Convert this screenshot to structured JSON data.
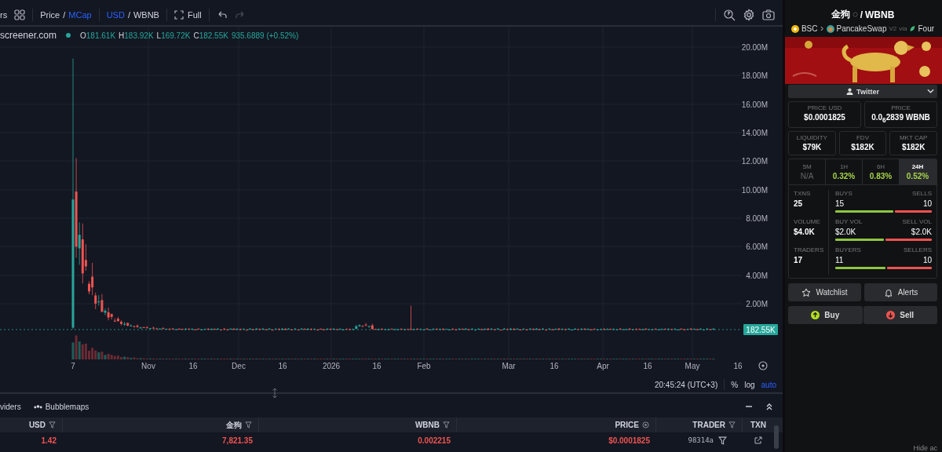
{
  "toolbar": {
    "cut_label": "rs",
    "toggles": [
      {
        "separator": "/",
        "options": [
          {
            "label": "Price",
            "selected": false
          },
          {
            "label": "MCap",
            "selected": true
          }
        ]
      },
      {
        "separator": "/",
        "options": [
          {
            "label": "USD",
            "selected": true
          },
          {
            "label": "WBNB",
            "selected": false
          }
        ]
      }
    ],
    "full_label": "Full",
    "redo_disabled": true
  },
  "legend": {
    "source": "screener.com",
    "ohlc": [
      {
        "label": "O",
        "value": "181.61K"
      },
      {
        "label": "H",
        "value": "183.92K"
      },
      {
        "label": "L",
        "value": "169.72K"
      },
      {
        "label": "C",
        "value": "182.55K"
      }
    ],
    "change": "935.6889 (+0.52%)"
  },
  "chart": {
    "y_axis": [
      "20.00M",
      "18.00M",
      "16.00M",
      "14.00M",
      "12.00M",
      "10.00M",
      "8.00M",
      "6.00M",
      "4.00M",
      "2.00M"
    ],
    "price_tag": "182.55K",
    "x_axis": [
      "7",
      "Nov",
      "16",
      "Dec",
      "16",
      "2026",
      "16",
      "Feb",
      "Mar",
      "16",
      "Apr",
      "16",
      "May",
      "16"
    ],
    "time": "20:45:24 (UTC+3)",
    "scale_buttons": [
      {
        "label": "%",
        "selected": false
      },
      {
        "label": "log",
        "selected": false
      },
      {
        "label": "auto",
        "selected": true
      }
    ]
  },
  "bottom_tabs": [
    {
      "label": "viders",
      "selected": false,
      "kind": "plain"
    },
    {
      "label": "Bubblemaps",
      "selected": false,
      "kind": "bubbles"
    }
  ],
  "table": {
    "columns": [
      {
        "label": "USD",
        "kind": "filter"
      },
      {
        "label": "金狗",
        "kind": "filter"
      },
      {
        "label": "WBNB",
        "kind": "filter"
      },
      {
        "label": "PRICE",
        "kind": "coin"
      },
      {
        "label": "TRADER",
        "kind": "filter"
      },
      {
        "label": "TXN",
        "kind": "none"
      }
    ],
    "rows": [
      {
        "cells": [
          "1.42",
          "7,821.35",
          "0.002215",
          "$0.0001825"
        ],
        "trader": "98314a"
      }
    ]
  },
  "pair": {
    "base": "金狗",
    "separator": "/",
    "quote": "WBNB",
    "chain": "BSC",
    "dex": "PancakeSwap",
    "version": "V2",
    "via": "via",
    "launchpad": "Four"
  },
  "social": {
    "label": "Twitter"
  },
  "price_cards": [
    {
      "label": "PRICE USD",
      "value": "$0.0001825"
    },
    {
      "label": "PRICE",
      "value": "0.0$_{6}$2839 WBNB"
    }
  ],
  "market_cards": [
    {
      "label": "LIQUIDITY",
      "value": "$79K"
    },
    {
      "label": "FDV",
      "value": "$182K"
    },
    {
      "label": "MKT CAP",
      "value": "$182K"
    }
  ],
  "timeframes": [
    {
      "label": "5M",
      "value": "N/A",
      "kind": "empty",
      "selected": false
    },
    {
      "label": "1H",
      "value": "0.32%",
      "kind": "gain",
      "selected": false
    },
    {
      "label": "6H",
      "value": "0.83%",
      "kind": "gain",
      "selected": false
    },
    {
      "label": "24H",
      "value": "0.52%",
      "kind": "gain",
      "selected": true
    }
  ],
  "activity": [
    {
      "label": "TXNS",
      "value": "25",
      "left_label": "BUYS",
      "right_label": "SELLS",
      "left_value": "15",
      "right_value": "10",
      "level": 0.6
    },
    {
      "label": "VOLUME",
      "value": "$4.0K",
      "left_label": "BUY VOL",
      "right_label": "SELL VOL",
      "left_value": "$2.0K",
      "right_value": "$2.0K",
      "level": 0.5
    },
    {
      "label": "TRADERS",
      "value": "17",
      "left_label": "BUYERS",
      "right_label": "SELLERS",
      "left_value": "11",
      "right_value": "10",
      "level": 0.52
    }
  ],
  "actions": [
    {
      "label": "Watchlist",
      "kind": "star"
    },
    {
      "label": "Alerts",
      "kind": "bell"
    }
  ],
  "trade": [
    {
      "label": "Buy",
      "kind": "buy"
    },
    {
      "label": "Sell",
      "kind": "sell"
    }
  ],
  "footer_hint": "Hide ac"
}
